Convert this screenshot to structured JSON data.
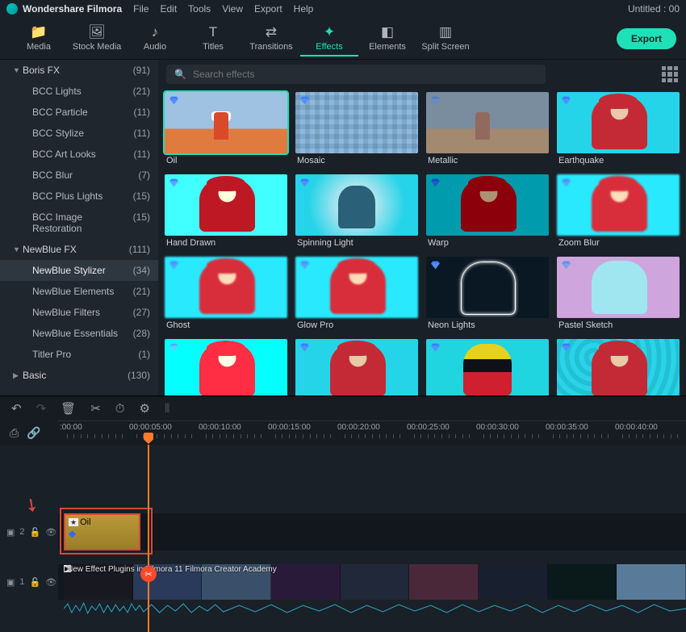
{
  "window": {
    "app": "Wondershare Filmora",
    "title_right": "Untitled : 00"
  },
  "menus": [
    "File",
    "Edit",
    "Tools",
    "View",
    "Export",
    "Help"
  ],
  "tabs": [
    {
      "icon": "📁",
      "label": "Media"
    },
    {
      "icon": "🖼",
      "label": "Stock Media"
    },
    {
      "icon": "♪",
      "label": "Audio"
    },
    {
      "icon": "T",
      "label": "Titles"
    },
    {
      "icon": "⇄",
      "label": "Transitions"
    },
    {
      "icon": "✦",
      "label": "Effects"
    },
    {
      "icon": "◧",
      "label": "Elements"
    },
    {
      "icon": "▥",
      "label": "Split Screen"
    }
  ],
  "active_tab": "Effects",
  "export_label": "Export",
  "search": {
    "placeholder": "Search effects"
  },
  "sidebar": [
    {
      "type": "group",
      "name": "Boris FX",
      "count": "(91)",
      "open": true
    },
    {
      "type": "item",
      "name": "BCC Lights",
      "count": "(21)"
    },
    {
      "type": "item",
      "name": "BCC Particle",
      "count": "(11)"
    },
    {
      "type": "item",
      "name": "BCC Stylize",
      "count": "(11)"
    },
    {
      "type": "item",
      "name": "BCC Art Looks",
      "count": "(11)"
    },
    {
      "type": "item",
      "name": "BCC Blur",
      "count": "(7)"
    },
    {
      "type": "item",
      "name": "BCC Plus Lights",
      "count": "(15)"
    },
    {
      "type": "item",
      "name": "BCC Image Restoration",
      "count": "(15)"
    },
    {
      "type": "group",
      "name": "NewBlue FX",
      "count": "(111)",
      "open": true
    },
    {
      "type": "item",
      "name": "NewBlue Stylizer",
      "count": "(34)",
      "sel": true
    },
    {
      "type": "item",
      "name": "NewBlue Elements",
      "count": "(21)"
    },
    {
      "type": "item",
      "name": "NewBlue Filters",
      "count": "(27)"
    },
    {
      "type": "item",
      "name": "NewBlue Essentials",
      "count": "(28)"
    },
    {
      "type": "item",
      "name": "Titler Pro",
      "count": "(1)"
    },
    {
      "type": "group",
      "name": "Basic",
      "count": "(130)",
      "open": false
    }
  ],
  "cards": [
    {
      "label": "Oil",
      "cls": "oil",
      "sel": true
    },
    {
      "label": "Mosaic",
      "cls": "tiled"
    },
    {
      "label": "Metallic",
      "cls": "metal"
    },
    {
      "label": "Earthquake",
      "cls": "person hat"
    },
    {
      "label": "Hand Drawn",
      "cls": "person hat sketch"
    },
    {
      "label": "Spinning Light",
      "cls": "spin"
    },
    {
      "label": "Warp",
      "cls": "person hat dark"
    },
    {
      "label": "Zoom Blur",
      "cls": "person hat blur"
    },
    {
      "label": "Ghost",
      "cls": "person hat blur"
    },
    {
      "label": "Glow Pro",
      "cls": "person hat blur"
    },
    {
      "label": "Neon Lights",
      "cls": "neon"
    },
    {
      "label": "Pastel Sketch",
      "cls": "pastel"
    },
    {
      "label": "",
      "cls": "person hat bright"
    },
    {
      "label": "",
      "cls": "person hat"
    },
    {
      "label": "",
      "cls": "poster"
    },
    {
      "label": "",
      "cls": "person hat bgtex"
    }
  ],
  "timeline": {
    "marks": [
      ":00:00",
      "00:00:05:00",
      "00:00:10:00",
      "00:00:15:00",
      "00:00:20:00",
      "00:00:25:00",
      "00:00:30:00",
      "00:00:35:00",
      "00:00:40:00"
    ],
    "fx_clip": "Oil",
    "video_clip": "New Effect Plugins in Filmora 11   Filmora Creator Academy",
    "track2": "2",
    "track1": "1"
  }
}
